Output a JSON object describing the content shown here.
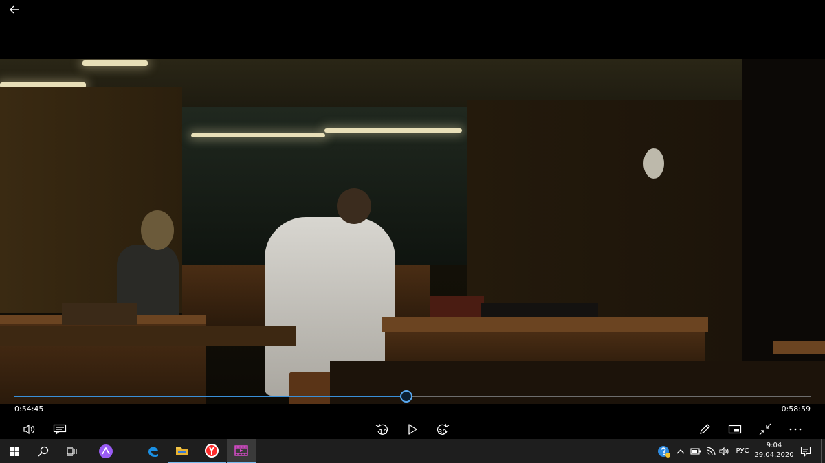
{
  "window": {
    "title": ""
  },
  "player": {
    "current_time": "0:54:45",
    "total_time": "0:58:59",
    "progress": 0.4925,
    "skip_back_label": "10",
    "skip_forward_label": "30"
  },
  "taskbar": {
    "language": "РУС",
    "time": "9:04",
    "date": "29.04.2020"
  },
  "colors": {
    "accent": "#3a8fd8",
    "taskbar": "#1e1e1e",
    "yandex": "#ff2b2b",
    "alice": "#9a5cf5",
    "edge": "#1a8fe3"
  },
  "icons": {
    "back": "arrow-left-icon",
    "volume": "speaker-icon",
    "subtitles": "subtitles-icon",
    "skip_back": "rewind-10-icon",
    "play": "play-icon",
    "skip_forward": "forward-30-icon",
    "edit": "pencil-icon",
    "miniview": "mini-view-icon",
    "exit_fullscreen": "exit-fullscreen-icon",
    "more": "more-icon"
  }
}
